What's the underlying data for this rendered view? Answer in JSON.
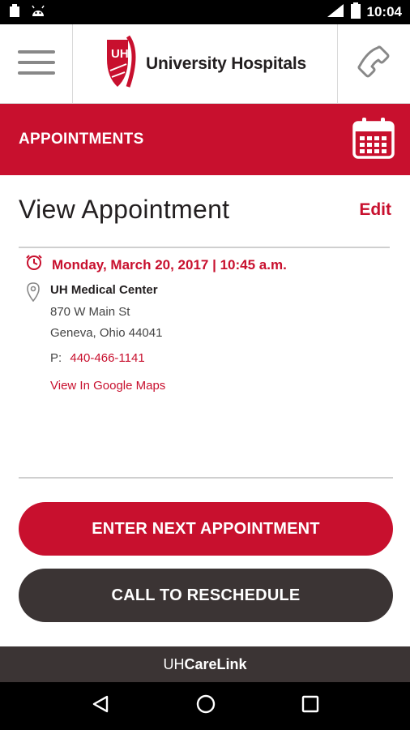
{
  "status_bar": {
    "time": "10:04",
    "icons": [
      "notification-icon",
      "android-icon",
      "signal-icon",
      "battery-icon"
    ]
  },
  "header": {
    "logo_text": "University Hospitals",
    "logo_mark": "UH",
    "icons": [
      "hamburger-menu-icon",
      "phone-icon"
    ]
  },
  "banner": {
    "title": "APPOINTMENTS",
    "icon": "calendar-icon"
  },
  "page": {
    "title": "View Appointment",
    "edit_label": "Edit"
  },
  "appointment": {
    "datetime": "Monday, March 20, 2017 | 10:45 a.m.",
    "location_name": "UH Medical Center",
    "address_line1": "870 W Main St",
    "address_line2": "Geneva, Ohio 44041",
    "phone_label": "P:",
    "phone_number": "440-466-1141",
    "maps_link": "View In Google Maps"
  },
  "actions": {
    "primary_label": "ENTER NEXT APPOINTMENT",
    "secondary_label": "CALL TO RESCHEDULE"
  },
  "footer": {
    "brand_prefix": "UH",
    "brand_suffix": "CareLink"
  },
  "colors": {
    "brand_red": "#c8102e",
    "dark": "#3b3434",
    "text": "#231f20"
  }
}
